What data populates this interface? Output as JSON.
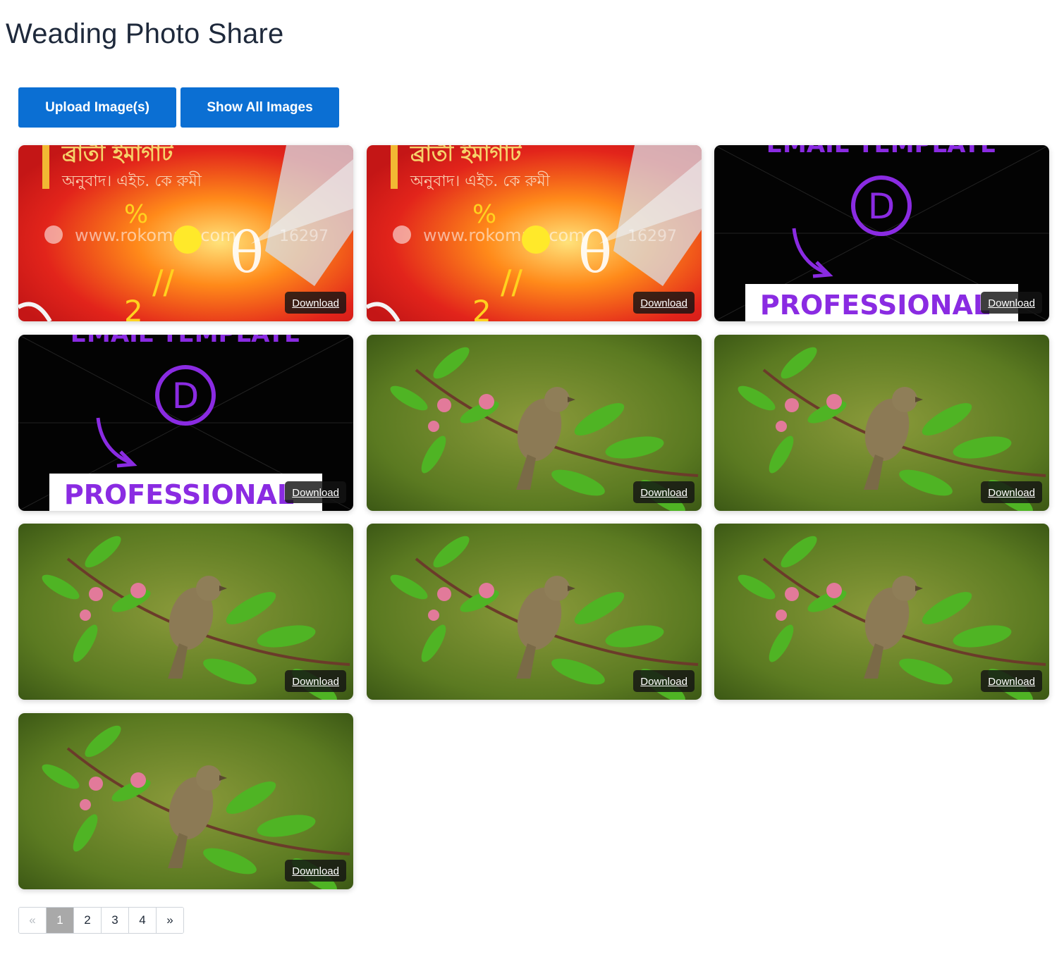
{
  "app": {
    "title": "Weading Photo Share"
  },
  "toolbar": {
    "upload_label": "Upload Image(s)",
    "show_all_label": "Show All Images",
    "accent": "#0b6fd3"
  },
  "gallery": {
    "download_label": "Download",
    "items": [
      {
        "kind": "book-cover",
        "text_line1": "ব্রাতী ইমাগাট",
        "text_line2": "অনুবাদ। এইচ. কে রুমী",
        "watermark": "www.rokomari.com",
        "code": "16297"
      },
      {
        "kind": "book-cover",
        "text_line1": "ব্রাতী ইমাগাট",
        "text_line2": "অনুবাদ। এইচ. কে রুমী",
        "watermark": "www.rokomari.com",
        "code": "16297"
      },
      {
        "kind": "divi-banner",
        "header": "EMAIL TEMPLATE",
        "logo": "D",
        "word": "PROFESSIONAL"
      },
      {
        "kind": "divi-banner",
        "header": "EMAIL TEMPLATE",
        "logo": "D",
        "word": "PROFESSIONAL"
      },
      {
        "kind": "bird-photo"
      },
      {
        "kind": "bird-photo"
      },
      {
        "kind": "bird-photo"
      },
      {
        "kind": "bird-photo"
      },
      {
        "kind": "bird-photo"
      },
      {
        "kind": "bird-photo"
      }
    ]
  },
  "pagination": {
    "prev": "«",
    "pages": [
      "1",
      "2",
      "3",
      "4"
    ],
    "current": "1",
    "next": "»"
  }
}
